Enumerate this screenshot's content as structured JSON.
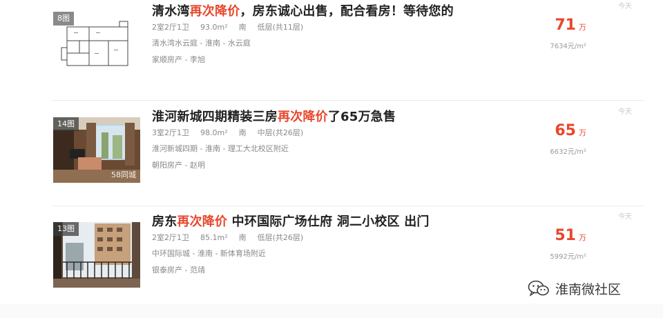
{
  "listings": [
    {
      "photo_count": "8图",
      "title_pre": "清水湾",
      "title_highlight": "再次降价",
      "title_post": "，房东诚心出售，配合看房！等待您的",
      "layout": "2室2厅1卫",
      "area": "93.0m²",
      "orientation": "南",
      "floor": "低层(共11层)",
      "community": "清水湾水云庭 - 淮南 - 水云庭",
      "agent": "家顺房产 - 李旭",
      "date": "今天",
      "price": "71",
      "price_unit": "万",
      "unit_price": "7634元/m²",
      "thumb_kind": "floorplan"
    },
    {
      "photo_count": "14图",
      "photo_overlay": "58同城",
      "title_pre": "淮河新城四期精装三房",
      "title_highlight": "再次降价",
      "title_post": "了65万急售",
      "layout": "3室2厅1卫",
      "area": "98.0m²",
      "orientation": "南",
      "floor": "中层(共26层)",
      "community": "淮河新城四期 - 淮南 - 理工大北校区附近",
      "agent": "朝阳房产 - 赵明",
      "date": "今天",
      "price": "65",
      "price_unit": "万",
      "unit_price": "6632元/m²",
      "thumb_kind": "living-room"
    },
    {
      "photo_count": "13图",
      "title_pre": "房东",
      "title_highlight": "再次降价",
      "title_post": " 中环国际广场仕府 洞二小校区 出门",
      "layout": "2室2厅1卫",
      "area": "85.1m²",
      "orientation": "南",
      "floor": "低层(共26层)",
      "community": "中环国际城 - 淮南 - 新体育场附近",
      "agent": "银泰房产 - 范靖",
      "date": "今天",
      "price": "51",
      "price_unit": "万",
      "unit_price": "5992元/m²",
      "thumb_kind": "balcony"
    }
  ],
  "watermark": {
    "text": "淮南微社区",
    "icon": "wechat-icon"
  },
  "colors": {
    "highlight": "#e8472c",
    "muted": "#888888",
    "title": "#222222"
  }
}
